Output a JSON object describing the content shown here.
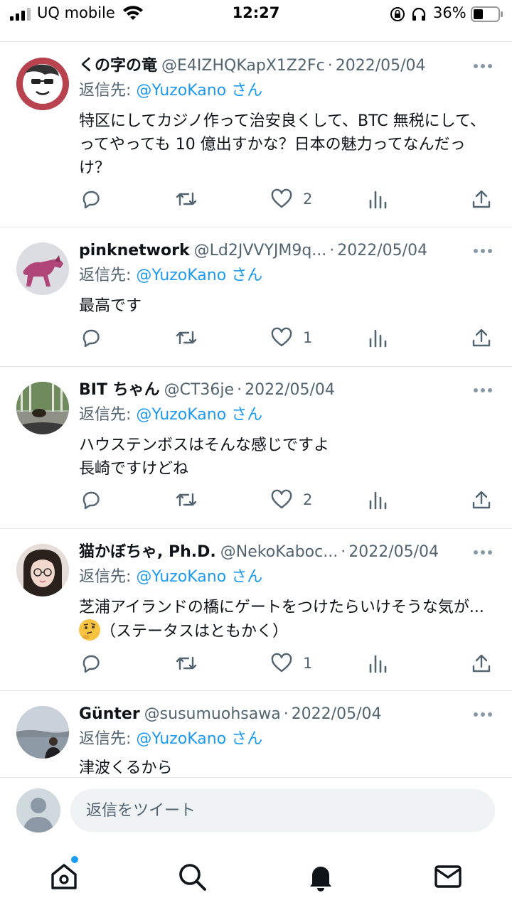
{
  "status_bar": {
    "carrier": "UQ mobile",
    "time": "12:27",
    "battery_percent": "36%"
  },
  "tweets": [
    {
      "display_name": "くの字の竜",
      "handle": "@E4IZHQKapX1Z2Fc",
      "dot": "·",
      "date": "2022/05/04",
      "reply_prefix": "返信先: ",
      "reply_to": "@YuzoKano さん",
      "text": "特区にしてカジノ作って治安良くして、BTC 無税にして、ってやっても 10 億出すかな？日本の魅力ってなんだっけ？",
      "likes": "2"
    },
    {
      "display_name": "pinknetwork",
      "handle": "@Ld2JVVYJM9q...",
      "dot": "·",
      "date": "2022/05/04",
      "reply_prefix": "返信先: ",
      "reply_to": "@YuzoKano さん",
      "text": "最高です",
      "likes": "1"
    },
    {
      "display_name": "BIT ちゃん",
      "handle": "@CT36je",
      "dot": "·",
      "date": "2022/05/04",
      "reply_prefix": "返信先: ",
      "reply_to": "@YuzoKano さん",
      "text": "ハウステンボスはそんな感じですよ\n長崎ですけどね",
      "likes": "2"
    },
    {
      "display_name": "猫かぼちゃ, Ph.D.",
      "handle": "@NekoKaboc...",
      "dot": "·",
      "date": "2022/05/04",
      "reply_prefix": "返信先: ",
      "reply_to": "@YuzoKano さん",
      "text": "芝浦アイランドの橋にゲートをつけたらいけそうな気が...",
      "text_suffix": "（ステータスはともかく）",
      "likes": "1"
    },
    {
      "display_name": "Günter",
      "handle": "@susumuohsawa",
      "dot": "·",
      "date": "2022/05/04",
      "reply_prefix": "返信先: ",
      "reply_to": "@YuzoKano さん",
      "text": "津波くるから"
    }
  ],
  "composer": {
    "placeholder": "返信をツイート"
  },
  "icons": {
    "reply": "reply-icon",
    "retweet": "retweet-icon",
    "like": "heart-icon",
    "views": "analytics-icon",
    "share": "share-icon",
    "more": "more-icon",
    "emoji": "thinking-face-emoji"
  },
  "colors": {
    "accent": "#1d9bf0",
    "secondary_text": "#536471",
    "divider": "#e6e9ec"
  }
}
